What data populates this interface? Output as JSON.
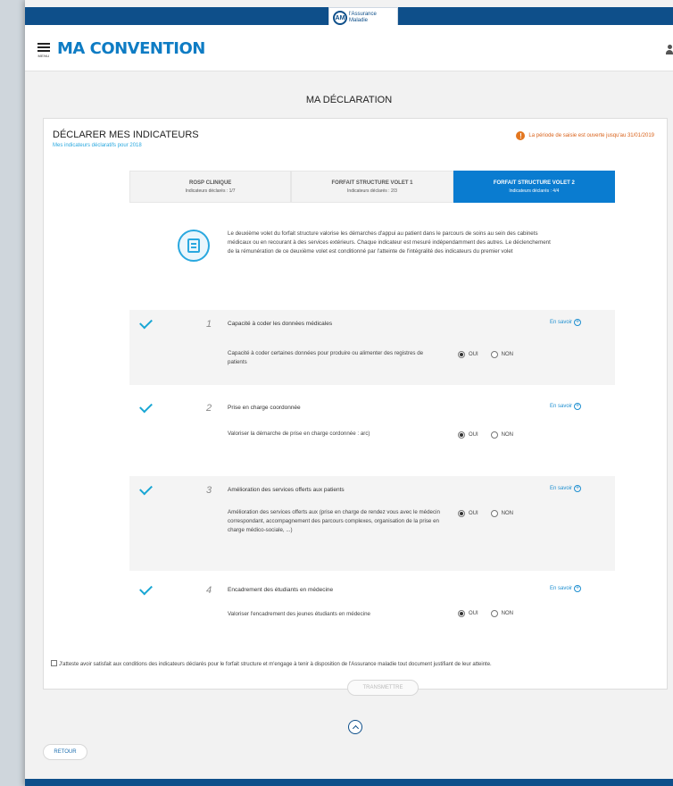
{
  "brand": {
    "logo_line1": "l'Assurance",
    "logo_line2": "Maladie",
    "color": "#0e4f8a"
  },
  "header": {
    "menu_label": "MENU",
    "app_title": "MA CONVENTION"
  },
  "page": {
    "title": "MA DÉCLARATION"
  },
  "card": {
    "title": "DÉCLARER MES INDICATEURS",
    "subtitle": "Mes indicateurs déclaratifs pour 2018",
    "notice": "La période de saisie est ouverte jusqu'au 31/01/2019"
  },
  "tabs": [
    {
      "name": "ROSP CLINIQUE",
      "count": "Indicateurs déclarés : 1/7",
      "active": false
    },
    {
      "name": "FORFAIT STRUCTURE VOLET 1",
      "count": "Indicateurs déclarés : 2/3",
      "active": false
    },
    {
      "name": "FORFAIT STRUCTURE VOLET 2",
      "count": "Indicateurs déclarés : 4/4",
      "active": true
    }
  ],
  "intro": {
    "text": "Le deuxième volet du forfait structure valorise les démarches d'appui au patient dans le parcours de soins au sein des cabinets médicaux ou en recourant à des services extérieurs. Chaque indicateur est mesuré indépendamment des autres. Le déclenchement de la rémunération de ce deuxième volet est conditionné par l'atteinte de l'intégralité des indicateurs du premier volet"
  },
  "indicators": [
    {
      "number": "1",
      "title": "Capacité à coder les données médicales",
      "description": "Capacité à coder certaines données pour produire ou alimenter des registres de patients",
      "more": "En savoir",
      "yes": "OUI",
      "no": "NON",
      "selected": "OUI"
    },
    {
      "number": "2",
      "title": "Prise en charge coordonnée",
      "description": "Valoriser la démarche de prise en charge cordonnée : arc)",
      "more": "En savoir",
      "yes": "OUI",
      "no": "NON",
      "selected": "OUI"
    },
    {
      "number": "3",
      "title": "Amélioration des services offerts aux patients",
      "description": "Amélioration des services offerts aux (prise en charge de rendez vous avec le médecin correspondant, accompagnement des parcours complexes, organisation de la prise en charge médico-sociale, ...)",
      "more": "En savoir",
      "yes": "OUI",
      "no": "NON",
      "selected": "OUI"
    },
    {
      "number": "4",
      "title": "Encadrement des étudiants en médecine",
      "description": "Valoriser l'encadrement des jeunes étudiants en médecine",
      "more": "En savoir",
      "yes": "OUI",
      "no": "NON",
      "selected": "OUI"
    }
  ],
  "attestation": "J'atteste avoir satisfait aux conditions des indicateurs déclarés pour le forfait structure et m'engage à tenir à disposition de l'Assurance maladie tout document justifiant de leur atteinte.",
  "actions": {
    "transmit": "TRANSMETTRE",
    "back": "RETOUR"
  },
  "colors": {
    "accent": "#0a7cd0",
    "warning": "#e3761f",
    "check": "#18a6d4"
  }
}
